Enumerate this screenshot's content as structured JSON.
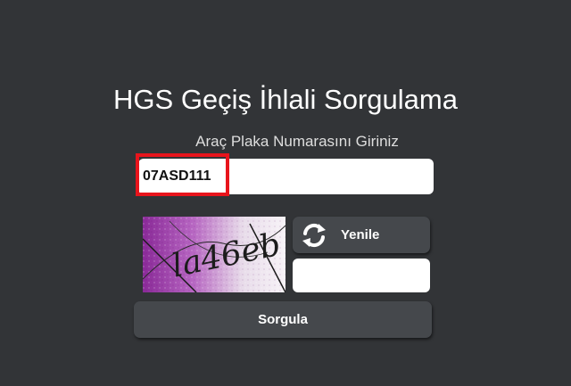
{
  "form": {
    "title": "HGS Geçiş İhlali Sorgulama",
    "plate_label": "Araç Plaka Numarasını Giriniz",
    "plate_value": "07ASD111",
    "captcha_text": "la46eb",
    "captcha_input_value": "",
    "refresh_label": "Yenile",
    "refresh_icon": "refresh-icon",
    "submit_label": "Sorgula"
  },
  "colors": {
    "background": "#323437",
    "button": "#45484c",
    "highlight": "#e8141c",
    "captcha_tint": "#a03fb0"
  }
}
